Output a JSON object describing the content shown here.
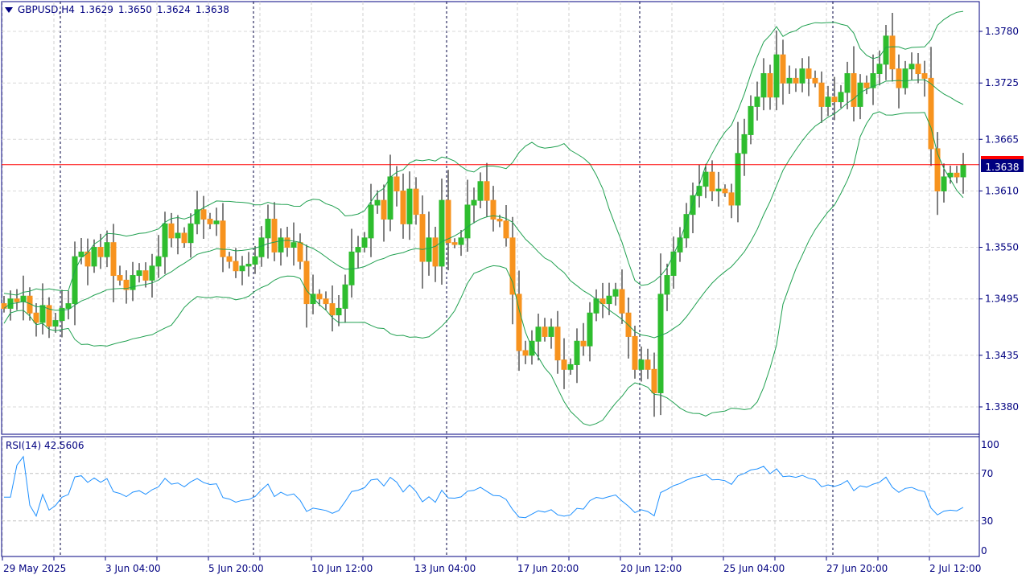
{
  "header": {
    "symbol": "GBPUSD,H4",
    "open": "1.3629",
    "high": "1.3650",
    "low": "1.3624",
    "close": "1.3638"
  },
  "current_price_label": "1.3638",
  "rsi_label": "RSI(14) 42.5606",
  "colors": {
    "bull": "#2ebd2e",
    "bear": "#f7931e",
    "bands": "#20a050",
    "rsi": "#1e90ff",
    "axis": "#000080",
    "price_line": "#ff0000"
  },
  "chart_data": {
    "type": "candlestick",
    "title": "GBPUSD,H4",
    "price_ticks": [
      "1.3780",
      "1.3725",
      "1.3665",
      "1.3610",
      "1.3550",
      "1.3495",
      "1.3435",
      "1.3380"
    ],
    "price_tick_values": [
      1.378,
      1.3725,
      1.3665,
      1.361,
      1.355,
      1.3495,
      1.3435,
      1.338
    ],
    "rsi_ticks": [
      "100",
      "70",
      "30",
      "0"
    ],
    "rsi_tick_values": [
      100,
      70,
      30,
      0
    ],
    "date_labels": [
      "29 May 2025",
      "3 Jun 04:00",
      "5 Jun 20:00",
      "10 Jun 12:00",
      "13 Jun 04:00",
      "17 Jun 20:00",
      "20 Jun 12:00",
      "25 Jun 04:00",
      "27 Jun 20:00",
      "2 Jul 12:00"
    ],
    "indicators": [
      "Bollinger Bands(20,2)",
      "RSI(14)"
    ],
    "current_price": 1.3638,
    "closes": [
      1.3485,
      1.3495,
      1.3492,
      1.3498,
      1.348,
      1.347,
      1.3488,
      1.3466,
      1.3472,
      1.3485,
      1.349,
      1.354,
      1.3545,
      1.353,
      1.355,
      1.354,
      1.3555,
      1.352,
      1.3515,
      1.3505,
      1.352,
      1.3525,
      1.3515,
      1.353,
      1.354,
      1.3575,
      1.356,
      1.3565,
      1.3555,
      1.3575,
      1.359,
      1.358,
      1.3575,
      1.3578,
      1.354,
      1.3535,
      1.3525,
      1.353,
      1.3532,
      1.354,
      1.356,
      1.358,
      1.3545,
      1.356,
      1.355,
      1.3555,
      1.3535,
      1.349,
      1.35,
      1.3495,
      1.349,
      1.3478,
      1.3485,
      1.351,
      1.3545,
      1.355,
      1.356,
      1.3595,
      1.36,
      1.358,
      1.3625,
      1.361,
      1.3575,
      1.3612,
      1.3585,
      1.3535,
      1.356,
      1.353,
      1.36,
      1.3555,
      1.3553,
      1.356,
      1.3595,
      1.36,
      1.362,
      1.36,
      1.358,
      1.3578,
      1.356,
      1.35,
      1.344,
      1.3435,
      1.345,
      1.3465,
      1.3455,
      1.3465,
      1.343,
      1.342,
      1.3425,
      1.345,
      1.3445,
      1.348,
      1.3495,
      1.349,
      1.3498,
      1.3505,
      1.348,
      1.3455,
      1.342,
      1.343,
      1.342,
      1.3395,
      1.35,
      1.352,
      1.3545,
      1.356,
      1.3585,
      1.3605,
      1.3615,
      1.363,
      1.361,
      1.3612,
      1.3608,
      1.3595,
      1.365,
      1.367,
      1.37,
      1.371,
      1.3735,
      1.371,
      1.3755,
      1.3725,
      1.373,
      1.3725,
      1.374,
      1.373,
      1.3725,
      1.37,
      1.371,
      1.3705,
      1.3715,
      1.3735,
      1.37,
      1.3725,
      1.372,
      1.3735,
      1.3745,
      1.3775,
      1.374,
      1.372,
      1.374,
      1.3745,
      1.3735,
      1.373,
      1.3655,
      1.361,
      1.3625,
      1.3629,
      1.3625,
      1.3638
    ]
  }
}
